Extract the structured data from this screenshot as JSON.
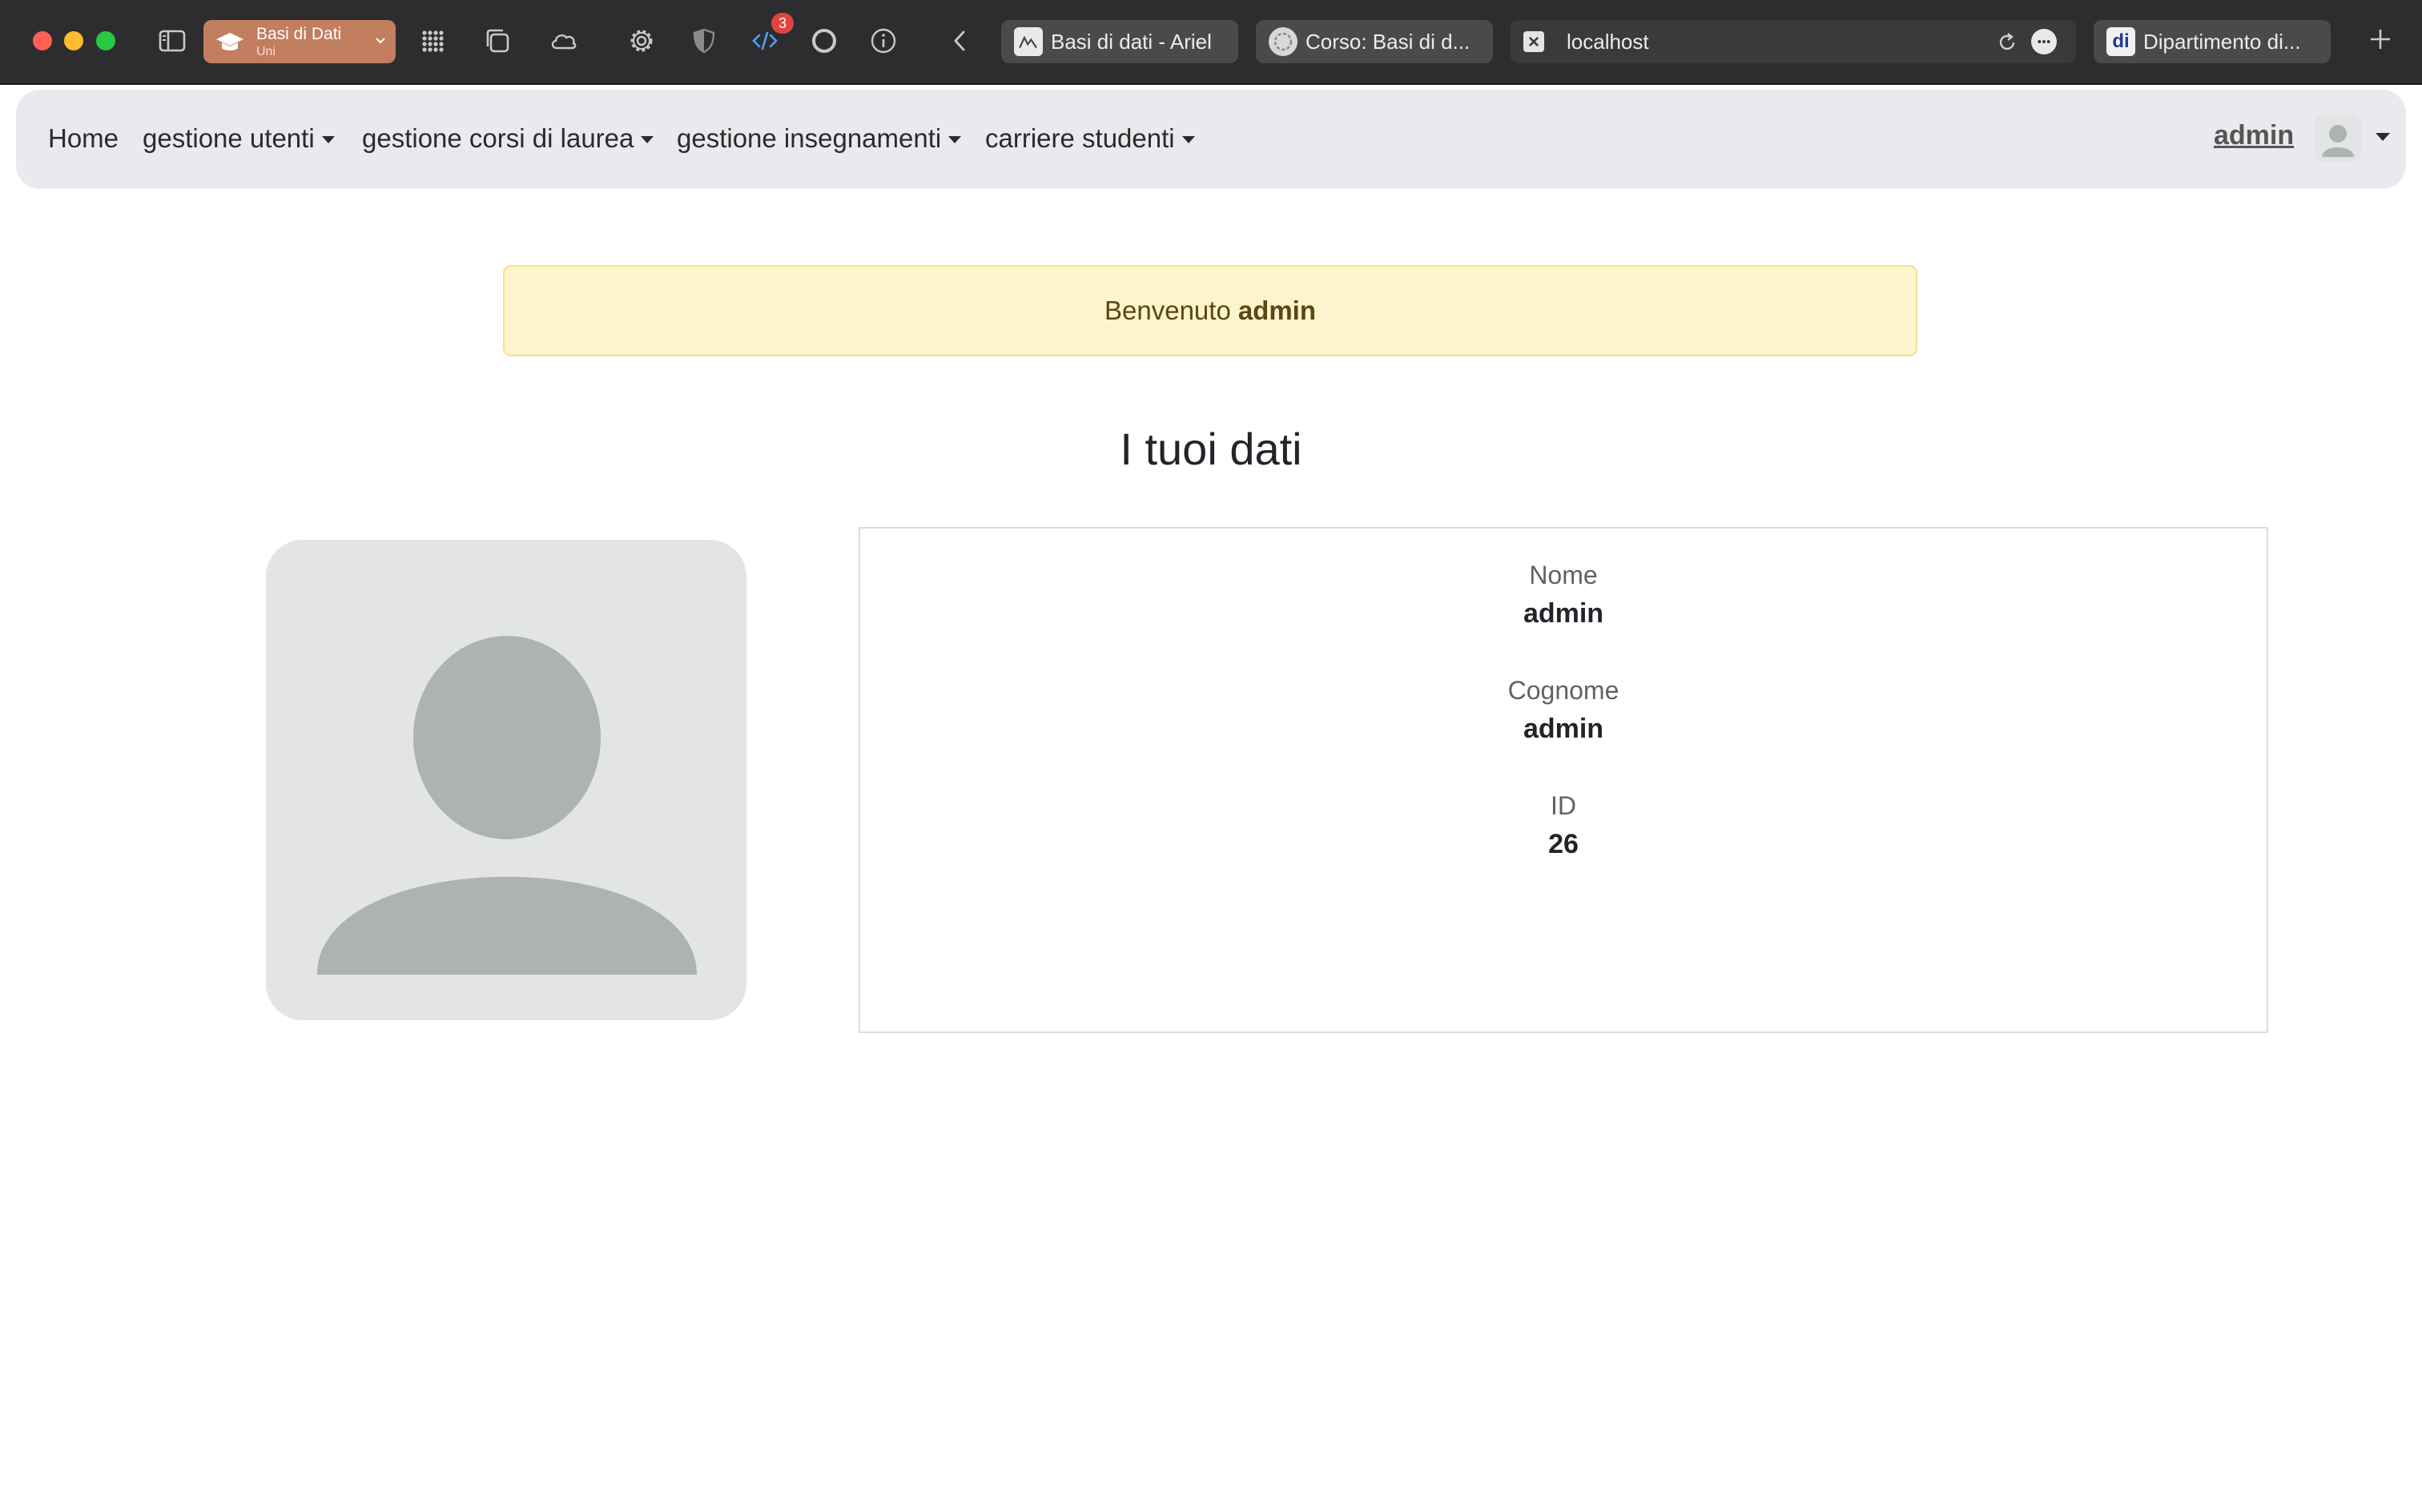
{
  "browser": {
    "tab_group": {
      "name": "Basi di Dati",
      "subtitle": "Uni"
    },
    "devtools_badge": "3",
    "tabs": [
      {
        "label": "Basi di dati - Ariel"
      },
      {
        "label": "Corso: Basi di d..."
      },
      {
        "label": "localhost",
        "active": true
      },
      {
        "label": "Dipartimento di..."
      }
    ],
    "favicon_text_last": "di"
  },
  "navbar": {
    "items": [
      {
        "label": "Home",
        "dropdown": false
      },
      {
        "label": "gestione utenti",
        "dropdown": true
      },
      {
        "label": "gestione corsi di laurea",
        "dropdown": true
      },
      {
        "label": "gestione insegnamenti",
        "dropdown": true
      },
      {
        "label": "carriere studenti",
        "dropdown": true
      }
    ],
    "user": {
      "name": "admin"
    }
  },
  "alert": {
    "prefix": "Benvenuto",
    "username": "admin"
  },
  "page": {
    "title": "I tuoi dati"
  },
  "profile": {
    "fields": [
      {
        "label": "Nome",
        "value": "admin"
      },
      {
        "label": "Cognome",
        "value": "admin"
      },
      {
        "label": "ID",
        "value": "26"
      }
    ]
  },
  "colors": {
    "alert_bg": "#fcf3cf",
    "alert_border": "#f7e08b",
    "navbar_bg": "#e9eaee",
    "tab_group": "#c27e5f",
    "avatar_bg": "#e3e4e6",
    "avatar_fg": "#adb2b3"
  }
}
